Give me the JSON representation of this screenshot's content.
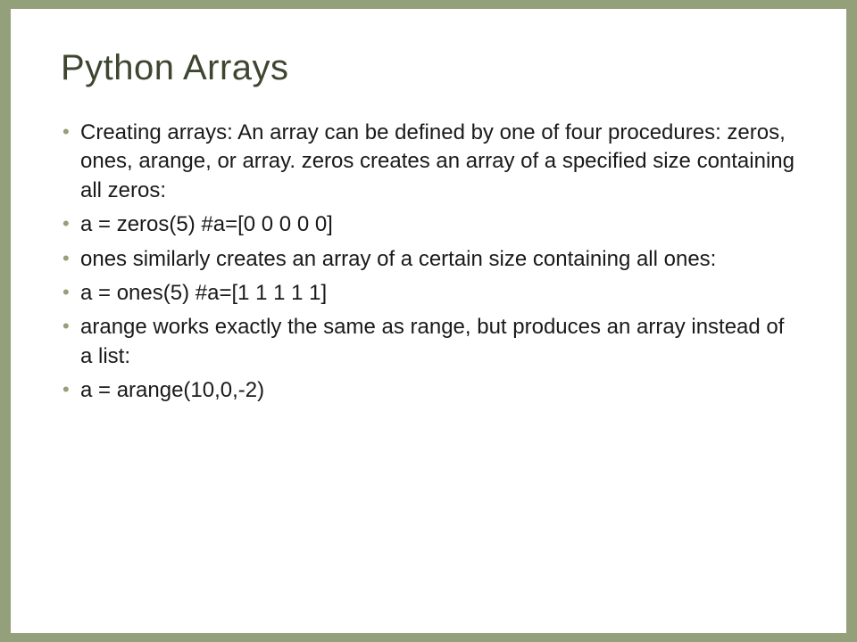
{
  "slide": {
    "title": "Python Arrays",
    "bullets": [
      "Creating arrays: An array can be defined by one of four procedures: zeros, ones, arange, or array. zeros creates an array of a specified size containing all zeros:",
      "a = zeros(5) #a=[0 0 0 0 0]",
      "ones similarly creates an array of a certain size containing all ones:",
      "a = ones(5) #a=[1 1 1 1 1]",
      "arange works exactly the same as range, but produces an array instead of a list:",
      "a = arange(10,0,-2)"
    ]
  }
}
